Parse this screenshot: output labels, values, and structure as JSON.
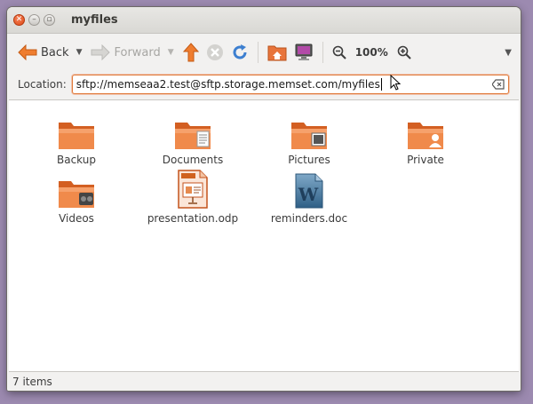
{
  "window": {
    "title": "myfiles"
  },
  "toolbar": {
    "back_label": "Back",
    "forward_label": "Forward",
    "zoom_level": "100%"
  },
  "location": {
    "label": "Location:",
    "value": "sftp://memseaa2.test@sftp.storage.memset.com/myfiles"
  },
  "files": [
    {
      "name": "Backup",
      "icon": "folder-icon"
    },
    {
      "name": "Documents",
      "icon": "folder-documents-icon"
    },
    {
      "name": "Pictures",
      "icon": "folder-pictures-icon"
    },
    {
      "name": "Private",
      "icon": "folder-private-icon"
    },
    {
      "name": "Videos",
      "icon": "folder-videos-icon"
    },
    {
      "name": "presentation.odp",
      "icon": "presentation-file-icon"
    },
    {
      "name": "reminders.doc",
      "icon": "word-document-icon"
    }
  ],
  "status": {
    "text": "7 items"
  },
  "colors": {
    "accent": "#e07a3a",
    "folder": "#e8743b",
    "desktop": "#9c8ab0"
  }
}
